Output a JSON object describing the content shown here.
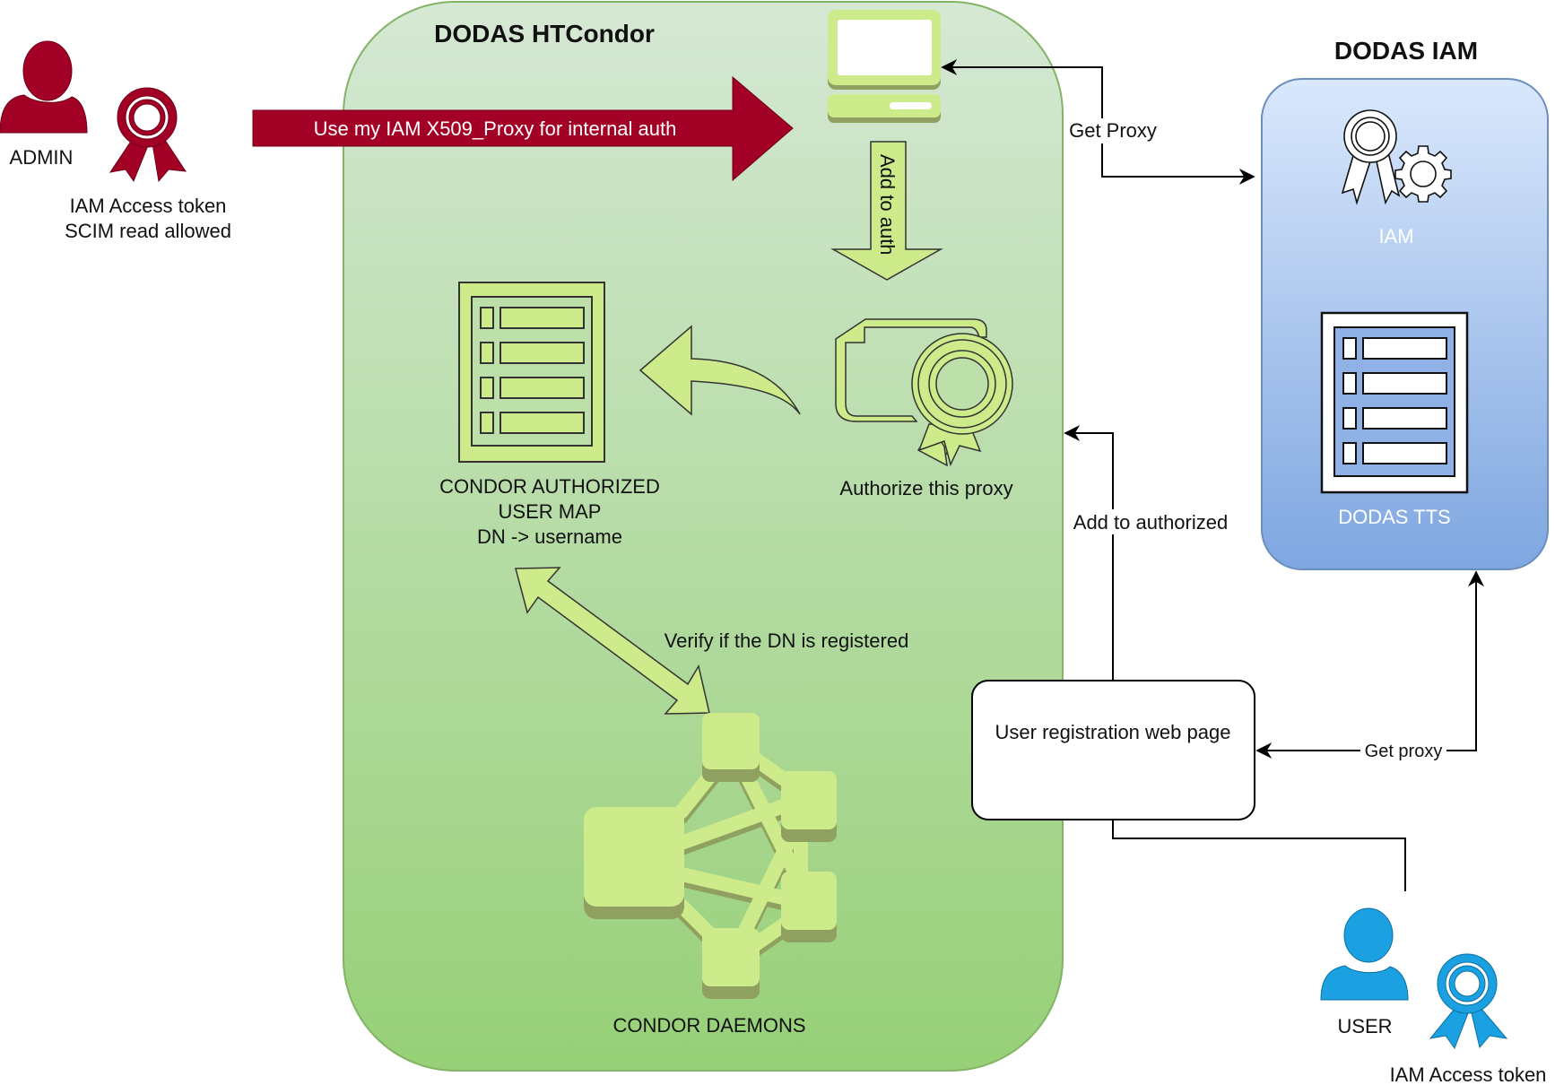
{
  "colors": {
    "admin_red": "#a20025",
    "user_blue": "#1ba1e2",
    "condor_green_top": "#d5e8d4",
    "condor_green_bottom": "#97d077",
    "condor_border": "#82b366",
    "icon_lime": "#cdeb8b",
    "icon_shadow": "#8fa060",
    "iam_blue_top": "#dae8fc",
    "iam_blue_bottom": "#7ea6e0",
    "iam_border": "#6c8ebf"
  },
  "admin": {
    "label": "ADMIN",
    "token_lines": [
      "IAM Access token",
      "SCIM read allowed"
    ],
    "action_arrow": "Use my IAM X509_Proxy for internal auth"
  },
  "htcondor": {
    "title": "DODAS HTCondor",
    "add_to_auth_arrow": "Add to auth",
    "authorize_label": "Authorize this proxy",
    "user_map_lines": [
      "CONDOR AUTHORIZED",
      "USER MAP",
      "DN -> username"
    ],
    "verify_label": "Verify if the DN is registered",
    "daemons_label": "CONDOR DAEMONS"
  },
  "iam": {
    "title": "DODAS IAM",
    "iam_label": "IAM",
    "tts_label": "DODAS TTS"
  },
  "edges": {
    "get_proxy_top": "Get Proxy",
    "add_to_authorized": "Add to authorized",
    "get_proxy_bottom": "Get proxy"
  },
  "registration": {
    "label": "User registration web page"
  },
  "user": {
    "label": "USER",
    "token_label": "IAM Access token"
  }
}
